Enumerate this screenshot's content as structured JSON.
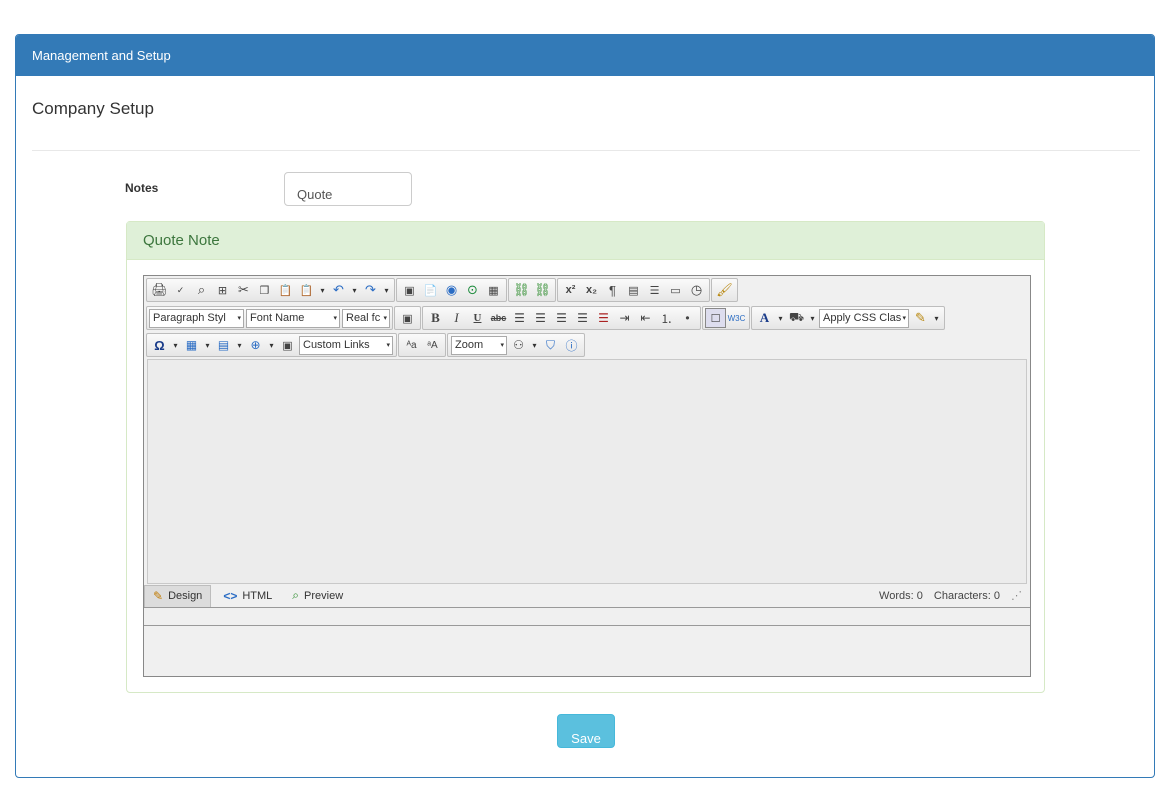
{
  "panel": {
    "title": "Management and Setup"
  },
  "page": {
    "title": "Company Setup"
  },
  "notes": {
    "label": "Notes",
    "selected": "Quote"
  },
  "quote_panel": {
    "title": "Quote Note"
  },
  "toolbar": {
    "paragraph_style": "Paragraph Styl",
    "font_name": "Font Name",
    "font_size": "Real fc",
    "apply_css": "Apply CSS Clas",
    "custom_links": "Custom Links",
    "zoom": "Zoom"
  },
  "modes": {
    "design": "Design",
    "html": "HTML",
    "preview": "Preview"
  },
  "counts": {
    "words": "Words: 0",
    "characters": "Characters: 0"
  },
  "save_label": "Save",
  "colors": {
    "primary": "#337ab7",
    "success_bg": "#dff0d8",
    "success_text": "#3c763d",
    "info": "#5bc0de"
  }
}
